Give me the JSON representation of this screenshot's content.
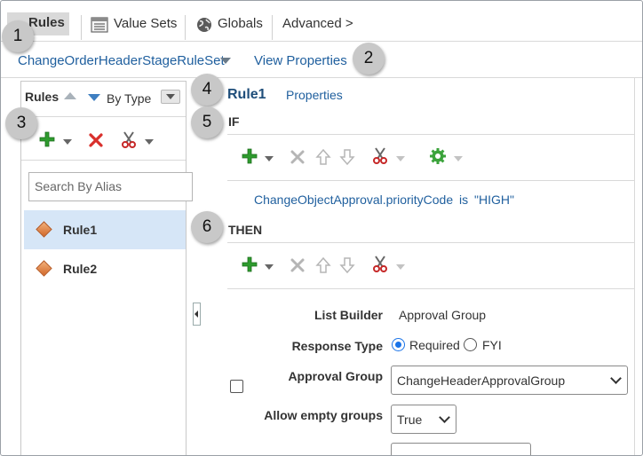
{
  "tabs": [
    {
      "label": "Rules",
      "icon": "rules-icon",
      "active": true
    },
    {
      "label": "Value Sets",
      "icon": "value-sets-icon"
    },
    {
      "label": "Globals",
      "icon": "globe-icon"
    },
    {
      "label": "Advanced >",
      "icon": ""
    }
  ],
  "ruleset": {
    "name": "ChangeOrderHeaderStageRuleSet",
    "view_properties": "View Properties"
  },
  "left_panel": {
    "title": "Rules",
    "sort_label": "By Type",
    "search_placeholder": "Search By Alias",
    "rules": [
      {
        "label": "Rule1",
        "selected": true
      },
      {
        "label": "Rule2",
        "selected": false
      }
    ]
  },
  "rule": {
    "title": "Rule1",
    "properties_link": "Properties",
    "if_label": "IF",
    "condition": {
      "field": "ChangeObjectApproval.priorityCode",
      "operator": "is",
      "value": "\"HIGH\""
    },
    "then_label": "THEN"
  },
  "form": {
    "list_builder_label": "List Builder",
    "list_builder_value": "Approval Group",
    "response_type_label": "Response Type",
    "response_options": [
      "Required",
      "FYI"
    ],
    "response_selected": "Required",
    "approval_group_label": "Approval Group",
    "approval_group_value": "ChangeHeaderApprovalGroup",
    "allow_empty_label": "Allow empty groups",
    "allow_empty_value": "True"
  },
  "callouts": [
    "1",
    "2",
    "3",
    "4",
    "5",
    "6"
  ],
  "colors": {
    "link": "#1f5f9e",
    "selected_row": "#d6e6f7",
    "add_green": "#2e9b2e",
    "delete_red": "#d9302c",
    "callout_gray": "#c8c8c8"
  }
}
